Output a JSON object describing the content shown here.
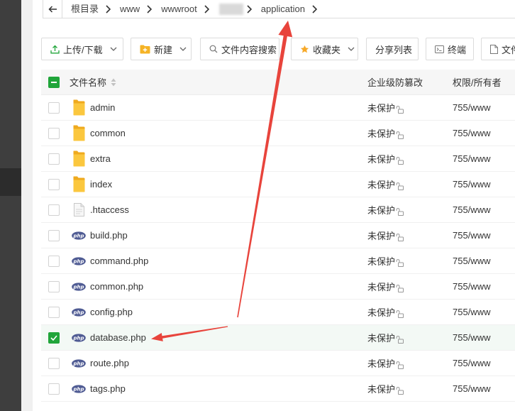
{
  "breadcrumb": {
    "back_icon": "arrow-left-icon",
    "separator_icon": "chevron-right-icon",
    "segments": [
      {
        "label": "根目录"
      },
      {
        "label": "www"
      },
      {
        "label": "wwwroot"
      },
      {
        "redacted": true
      },
      {
        "label": "application"
      }
    ]
  },
  "toolbar": {
    "upload_download": {
      "label": "上传/下载",
      "icon": "upload-icon",
      "dropdown": true
    },
    "new": {
      "label": "新建",
      "icon": "folder-plus-icon",
      "dropdown": true
    },
    "content_search": {
      "label": "文件内容搜索",
      "icon": "search-icon"
    },
    "favorites": {
      "label": "收藏夹",
      "icon": "star-icon",
      "dropdown": true
    },
    "share_list": {
      "label": "分享列表"
    },
    "terminal": {
      "label": "终端",
      "icon": "terminal-icon"
    },
    "more_file": {
      "label": "文件",
      "icon": "file-icon"
    }
  },
  "file_table": {
    "select_all_partial": true,
    "columns": {
      "name": "文件名称",
      "protection": "企业级防篡改",
      "permission": "权限/所有者"
    },
    "php_icon_text": "php",
    "rows": [
      {
        "name": "admin",
        "icon": "folder-icon",
        "protection": "未保护",
        "permission": "755/www",
        "checked": false
      },
      {
        "name": "common",
        "icon": "folder-icon",
        "protection": "未保护",
        "permission": "755/www",
        "checked": false
      },
      {
        "name": "extra",
        "icon": "folder-icon",
        "protection": "未保护",
        "permission": "755/www",
        "checked": false
      },
      {
        "name": "index",
        "icon": "folder-icon",
        "protection": "未保护",
        "permission": "755/www",
        "checked": false
      },
      {
        "name": ".htaccess",
        "icon": "file-icon",
        "protection": "未保护",
        "permission": "755/www",
        "checked": false
      },
      {
        "name": "build.php",
        "icon": "php-file-icon",
        "protection": "未保护",
        "permission": "755/www",
        "checked": false
      },
      {
        "name": "command.php",
        "icon": "php-file-icon",
        "protection": "未保护",
        "permission": "755/www",
        "checked": false
      },
      {
        "name": "common.php",
        "icon": "php-file-icon",
        "protection": "未保护",
        "permission": "755/www",
        "checked": false
      },
      {
        "name": "config.php",
        "icon": "php-file-icon",
        "protection": "未保护",
        "permission": "755/www",
        "checked": false
      },
      {
        "name": "database.php",
        "icon": "php-file-icon",
        "protection": "未保护",
        "permission": "755/www",
        "checked": true
      },
      {
        "name": "route.php",
        "icon": "php-file-icon",
        "protection": "未保护",
        "permission": "755/www",
        "checked": false
      },
      {
        "name": "tags.php",
        "icon": "php-file-icon",
        "protection": "未保护",
        "permission": "755/www",
        "checked": false
      }
    ]
  },
  "colors": {
    "accent": "#20a53a",
    "annotation": "#e8443c",
    "folder": "#fbc73e",
    "php_icon": "#4f5b93"
  }
}
